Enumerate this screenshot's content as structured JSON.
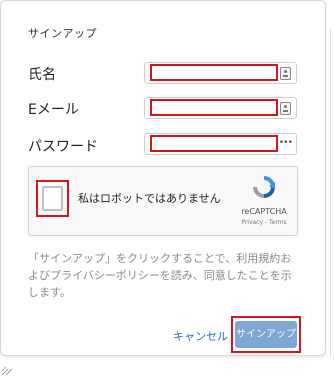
{
  "dialog": {
    "title": "サインアップ"
  },
  "fields": [
    {
      "label": "氏名",
      "value": "",
      "icon": "contact-card-icon"
    },
    {
      "label": "Eメール",
      "value": "",
      "icon": "contact-card-icon"
    },
    {
      "label": "パスワード",
      "value": "",
      "masked_hint": "•••"
    }
  ],
  "recaptcha": {
    "label": "私はロボットではありません",
    "brand": "reCAPTCHA",
    "links": "Privacy - Terms",
    "checked": false
  },
  "notice": "「サインアップ」をクリックすることで、利用規約およびプライバシーポリシーを読み、同意したことを示します。",
  "actions": {
    "cancel_label": "キャンセル",
    "signup_label": "サインアップ"
  },
  "colors": {
    "highlight": "#d8141c",
    "primary_button": "#7ea7d3",
    "link": "#2a6fb6"
  }
}
